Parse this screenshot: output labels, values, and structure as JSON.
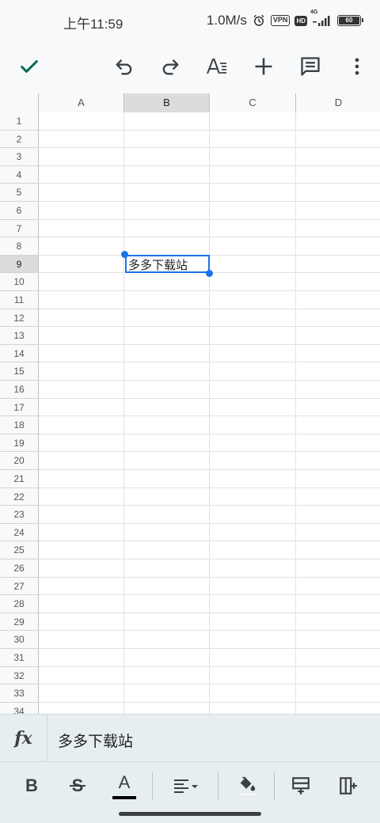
{
  "status_bar": {
    "time": "上午11:59",
    "net_speed": "1.0M/s",
    "vpn": "VPN",
    "hd": "HD",
    "network": "4G",
    "battery": "60"
  },
  "toolbar": {
    "icons": [
      "check-icon",
      "undo-icon",
      "redo-icon",
      "text-format-icon",
      "add-icon",
      "comment-icon",
      "more-vert-icon"
    ]
  },
  "sheet": {
    "columns": [
      "A",
      "B",
      "C",
      "D"
    ],
    "rows": [
      "1",
      "2",
      "3",
      "4",
      "5",
      "6",
      "7",
      "8",
      "9",
      "10",
      "11",
      "12",
      "13",
      "14",
      "15",
      "16",
      "17",
      "18",
      "19",
      "20",
      "21",
      "22",
      "23",
      "24",
      "25",
      "26",
      "27",
      "28",
      "29",
      "30",
      "31",
      "32",
      "33",
      "34"
    ],
    "selected_column": "B",
    "selected_row": "9",
    "selected_cell_value": "多多下载站"
  },
  "formula_bar": {
    "fx_label": "fx",
    "value": "多多下载站"
  },
  "format_bar": {
    "bold_label": "B",
    "strike_label": "S",
    "text_color_label": "A",
    "icons": [
      "bold-icon",
      "strikethrough-icon",
      "text-color-icon",
      "align-icon",
      "fill-color-icon",
      "insert-row-icon",
      "insert-column-icon"
    ],
    "text_color": "#000000",
    "fill_color": "#ffffff"
  },
  "colors": {
    "accent": "#1a73e8",
    "confirm_check": "#0b6b53",
    "header_bg": "#f8f9fa",
    "selected_header_bg": "#dcdcdc",
    "bottom_bar_bg": "#e6eef0"
  }
}
